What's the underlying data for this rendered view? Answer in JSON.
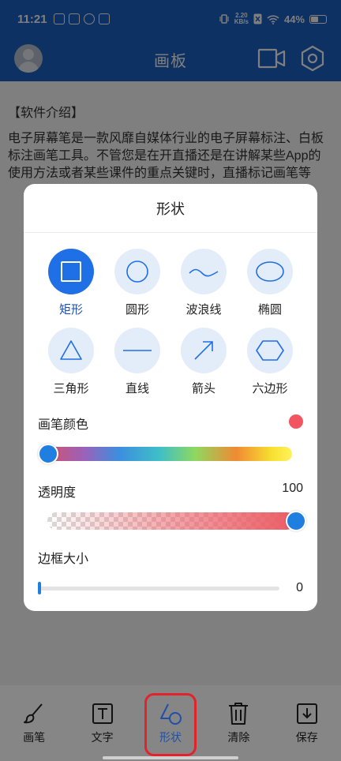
{
  "status_bar": {
    "time": "11:21",
    "net_speed_top": "2.20",
    "net_speed_bottom": "KB/s",
    "battery": "44%"
  },
  "app_bar": {
    "title": "画板"
  },
  "content": {
    "paragraphs": [
      "【软件介绍】",
      "电子屏幕笔是一款风靡自媒体行业的电子屏幕标注、白板标注画笔工具。不管您是在开直播还是在讲解某些App的使用方法或者某些课件的重点关键时，直播标记画笔等"
    ]
  },
  "dialog": {
    "title": "形状",
    "shapes": [
      {
        "label": "矩形",
        "icon": "square-icon",
        "selected": true
      },
      {
        "label": "圆形",
        "icon": "circle-icon",
        "selected": false
      },
      {
        "label": "波浪线",
        "icon": "wave-line-icon",
        "selected": false
      },
      {
        "label": "椭圆",
        "icon": "ellipse-icon",
        "selected": false
      },
      {
        "label": "三角形",
        "icon": "triangle-icon",
        "selected": false
      },
      {
        "label": "直线",
        "icon": "straight-line-icon",
        "selected": false
      },
      {
        "label": "箭头",
        "icon": "arrow-icon",
        "selected": false
      },
      {
        "label": "六边形",
        "icon": "hexagon-icon",
        "selected": false
      }
    ],
    "pen_color_label": "画笔颜色",
    "pen_color": "#f2555f",
    "color_slider_position": 0,
    "opacity_label": "透明度",
    "opacity_value": "100",
    "opacity_fraction": 1.0,
    "border_size_label": "边框大小",
    "border_size_value": "0",
    "border_size_fraction": 0
  },
  "toolbar": {
    "items": [
      {
        "label": "画笔",
        "icon": "brush-icon",
        "active": false
      },
      {
        "label": "文字",
        "icon": "text-icon",
        "active": false
      },
      {
        "label": "形状",
        "icon": "shape-icon",
        "active": true
      },
      {
        "label": "清除",
        "icon": "trash-icon",
        "active": false
      },
      {
        "label": "保存",
        "icon": "save-icon",
        "active": false
      }
    ]
  },
  "colors": {
    "primary": "#1d62c8",
    "accent": "#1f6fe6",
    "highlight": "#e2232a"
  }
}
